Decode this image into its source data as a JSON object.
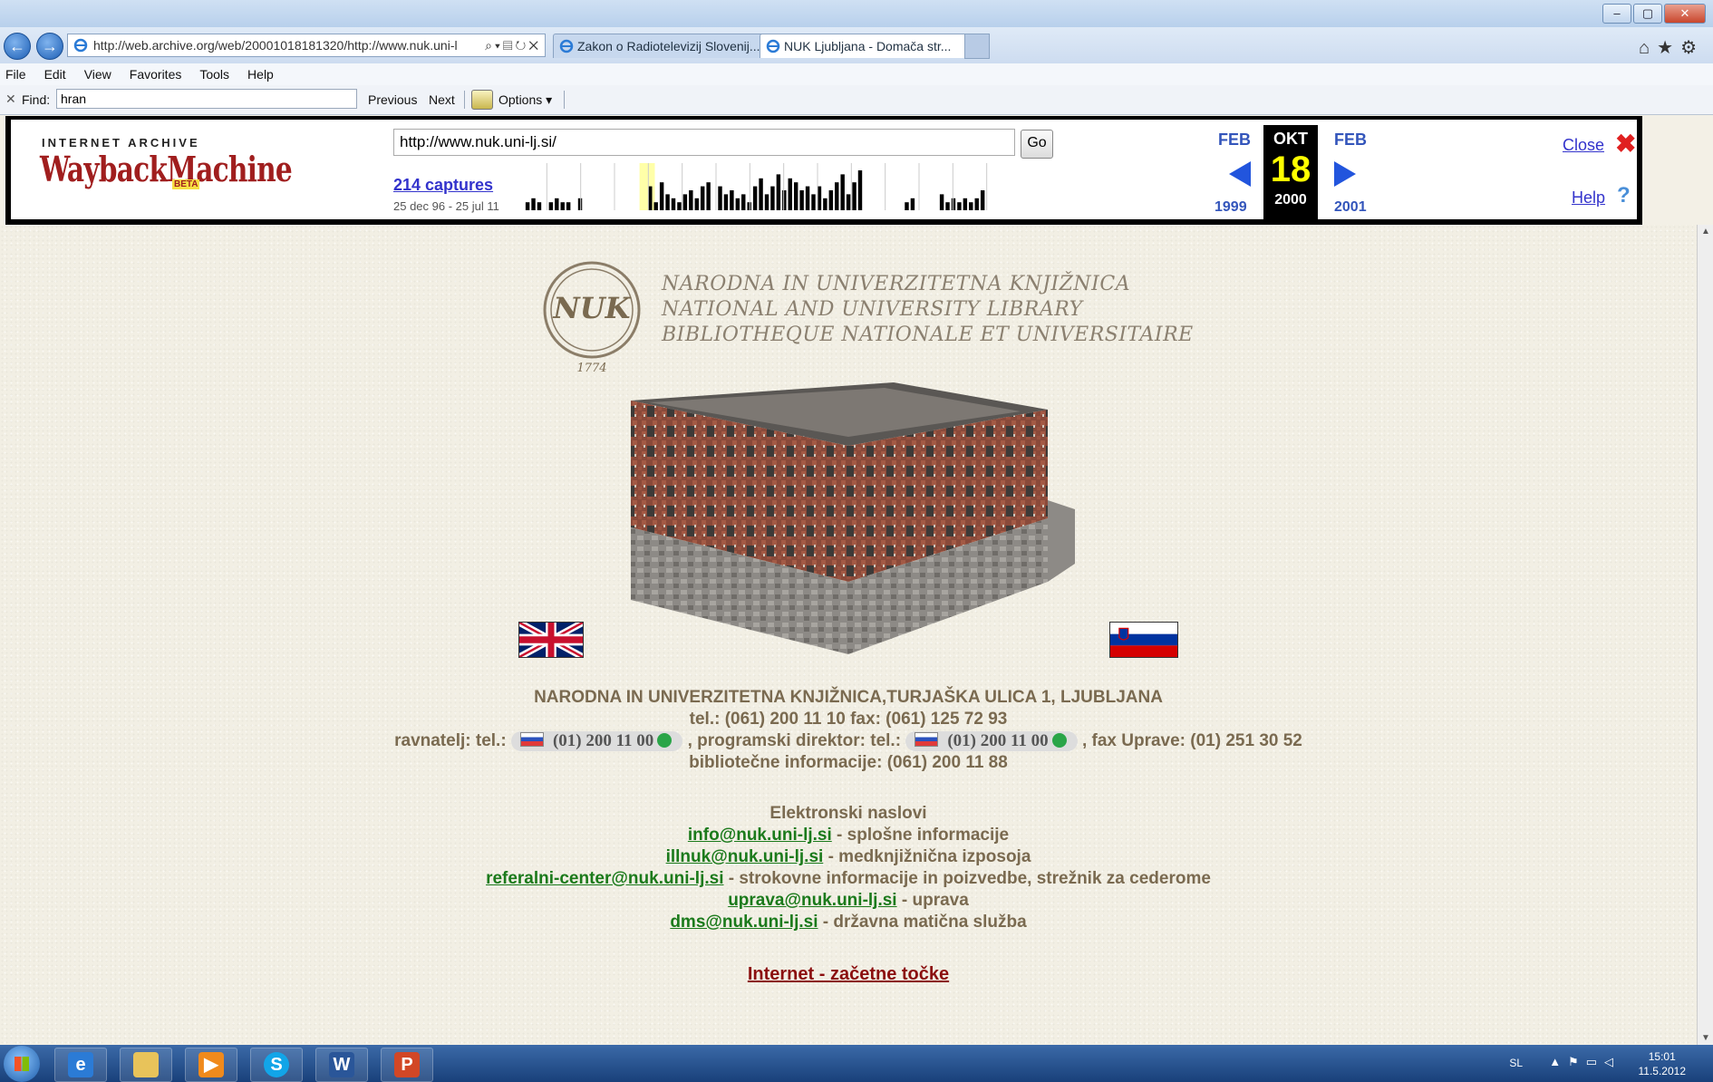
{
  "browser": {
    "tabs": [
      {
        "label": "Zakon o Radiotelevizij Slovenij..."
      },
      {
        "label": "NUK Ljubljana - Domača str..."
      }
    ],
    "address": "http://web.archive.org/web/20001018181320/http://www.nuk.uni-l",
    "menu": [
      "File",
      "Edit",
      "View",
      "Favorites",
      "Tools",
      "Help"
    ],
    "find": {
      "label": "Find:",
      "value": "hran",
      "previous": "Previous",
      "next": "Next",
      "options": "Options"
    }
  },
  "wayback": {
    "logo_top": "INTERNET ARCHIVE",
    "logo": "WaybackMachine",
    "beta": "BETA",
    "url": "http://www.nuk.uni-lj.si/",
    "go": "Go",
    "captures": "214 captures",
    "range": "25 dec 96 - 25 jul 11",
    "prev_month": "FEB",
    "prev_year": "1999",
    "cur_month": "OKT",
    "cur_day": "18",
    "cur_year": "2000",
    "next_month": "FEB",
    "next_year": "2001",
    "close": "Close",
    "help": "Help",
    "sparkline": [
      0,
      0,
      2,
      3,
      2,
      0,
      2,
      3,
      2,
      2,
      0,
      3,
      0,
      0,
      0,
      0,
      0,
      0,
      0,
      0,
      0,
      0,
      0,
      6,
      2,
      7,
      4,
      3,
      2,
      4,
      5,
      3,
      6,
      7,
      0,
      6,
      4,
      5,
      3,
      4,
      2,
      6,
      8,
      4,
      6,
      9,
      5,
      8,
      7,
      5,
      6,
      4,
      6,
      3,
      5,
      7,
      9,
      4,
      7,
      10,
      0,
      0,
      0,
      0,
      0,
      0,
      0,
      2,
      3,
      0,
      0,
      0,
      0,
      4,
      2,
      3,
      2,
      3,
      2,
      3,
      5,
      0,
      0,
      0,
      0,
      0,
      0
    ],
    "sparkline_highlight": 22
  },
  "page": {
    "logo_text": "NUK",
    "logo_year": "1774",
    "names": [
      "NARODNA IN UNIVERZITETNA KNJIŽNICA",
      "NATIONAL AND UNIVERSITY LIBRARY",
      "BIBLIOTHEQUE NATIONALE ET UNIVERSITAIRE"
    ],
    "address_line": "NARODNA IN UNIVERZITETNA KNJIŽNICA,TURJAŠKA ULICA 1, LJUBLJANA",
    "phone_line": "tel.: (061) 200 11 10 fax: (061) 125 72 93",
    "director_label": "ravnatelj: tel.:",
    "director_phone": "(01) 200 11 00",
    "program_label": ", programski direktor: tel.:",
    "program_phone": "(01) 200 11 00",
    "fax_uprave": ", fax Uprave: (01) 251 30 52",
    "info_line": "bibliotečne informacije: (061) 200 11 88",
    "emails_title": "Elektronski naslovi",
    "emails": [
      {
        "addr": "info@nuk.uni-lj.si",
        "desc": " - splošne informacije"
      },
      {
        "addr": "illnuk@nuk.uni-lj.si",
        "desc": " - medknjižnična izposoja"
      },
      {
        "addr": "referalni-center@nuk.uni-lj.si",
        "desc": " - strokovne informacije in poizvedbe, strežnik za cederome"
      },
      {
        "addr": "uprava@nuk.uni-lj.si",
        "desc": " - uprava"
      },
      {
        "addr": "dms@nuk.uni-lj.si",
        "desc": " - državna matična služba"
      }
    ],
    "internet_link": "Internet - začetne točke"
  },
  "taskbar": {
    "lang": "SL",
    "time": "15:01",
    "date": "11.5.2012"
  },
  "colors": {
    "wayback_link": "#3333cc",
    "email_link": "#1b7a1b",
    "internet_link": "#8b0f0f",
    "body_text": "#7a6a50"
  }
}
